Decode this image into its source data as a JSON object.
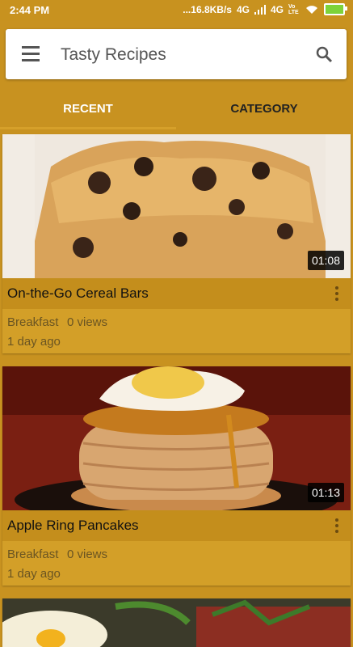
{
  "status_bar": {
    "time": "2:44 PM",
    "speed": "...16.8KB/s",
    "net1": "4G",
    "net2": "4G",
    "volte": "Vo LTE"
  },
  "header": {
    "title": "Tasty Recipes",
    "menu_icon": "hamburger-menu-icon",
    "search_icon": "search-icon"
  },
  "tabs": [
    {
      "label": "RECENT",
      "selected": true
    },
    {
      "label": "CATEGORY",
      "selected": false
    }
  ],
  "recipes": [
    {
      "title": "On-the-Go Cereal Bars",
      "duration": "01:08",
      "category": "Breakfast",
      "views": "0 views",
      "date": "1 day ago"
    },
    {
      "title": "Apple Ring Pancakes",
      "duration": "01:13",
      "category": "Breakfast",
      "views": "0 views",
      "date": "1 day ago"
    }
  ],
  "colors": {
    "background": "#c89220",
    "card": "#d39f28",
    "accent": "#d6a02a"
  }
}
